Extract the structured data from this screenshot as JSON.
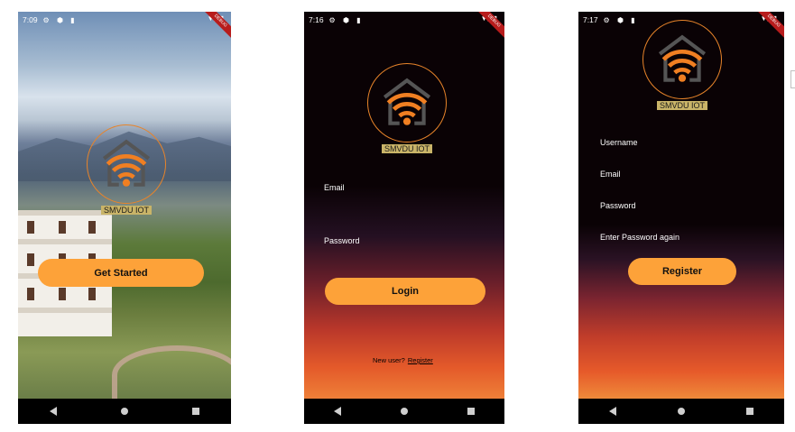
{
  "brand": {
    "name": "SMVDU IOT",
    "accent": "#fda239",
    "logo_orange": "#f07f22",
    "logo_gray": "#555555"
  },
  "screens": [
    {
      "id": "splash",
      "status_time": "7:09",
      "primary_button": "Get Started"
    },
    {
      "id": "login",
      "status_time": "7:16",
      "fields": [
        "Email",
        "Password"
      ],
      "primary_button": "Login",
      "footer_prompt": "New user?",
      "footer_link": "Register"
    },
    {
      "id": "register",
      "status_time": "7:17",
      "fields": [
        "Username",
        "Email",
        "Password",
        "Enter Password again"
      ],
      "primary_button": "Register"
    }
  ],
  "icons": {
    "status": [
      "gear-icon",
      "shield-icon",
      "sd-card-icon"
    ],
    "nav": [
      "back-icon",
      "home-icon",
      "recents-icon"
    ],
    "logo": "wifi-house-icon"
  },
  "debug_banner": "DEBUG"
}
